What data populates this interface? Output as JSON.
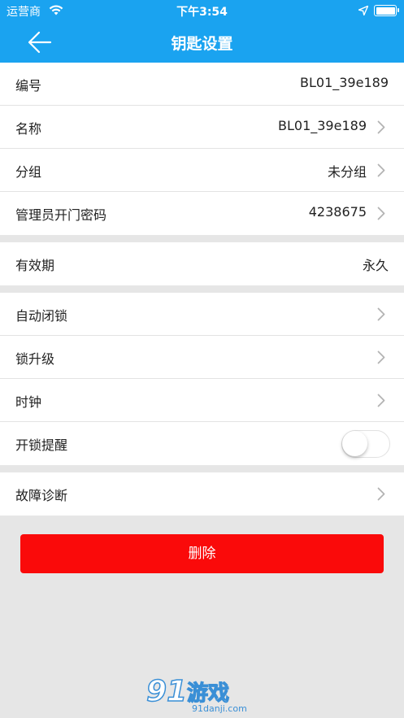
{
  "status_bar": {
    "carrier": "运营商",
    "time": "下午3:54",
    "icons": [
      "wifi-icon",
      "location-arrow-icon",
      "battery-icon"
    ]
  },
  "nav": {
    "title": "钥匙设置",
    "back_icon": "arrow-left-icon"
  },
  "groups": {
    "info": [
      {
        "label": "编号",
        "value": "BL01_39e189",
        "chevron": false
      },
      {
        "label": "名称",
        "value": "BL01_39e189",
        "chevron": true
      },
      {
        "label": "分组",
        "value": "未分组",
        "chevron": true
      },
      {
        "label": "管理员开门密码",
        "value": "4238675",
        "chevron": true
      }
    ],
    "validity": [
      {
        "label": "有效期",
        "value": "永久",
        "chevron": false
      }
    ],
    "functions": [
      {
        "label": "自动闭锁",
        "chevron": true
      },
      {
        "label": "锁升级",
        "chevron": true
      },
      {
        "label": "时钟",
        "chevron": true
      },
      {
        "label": "开锁提醒",
        "toggle_on": false
      }
    ],
    "diagnosis": [
      {
        "label": "故障诊断",
        "chevron": true
      }
    ]
  },
  "delete_button": {
    "label": "删除"
  },
  "watermark": {
    "logo": "91",
    "brand": "游戏",
    "url": "91danji.com"
  },
  "colors": {
    "header_blue": "#1aa3f0",
    "delete_red": "#fa0a0a",
    "page_background": "#e6e6e6",
    "chevron_gray": "#b3b3b3"
  }
}
